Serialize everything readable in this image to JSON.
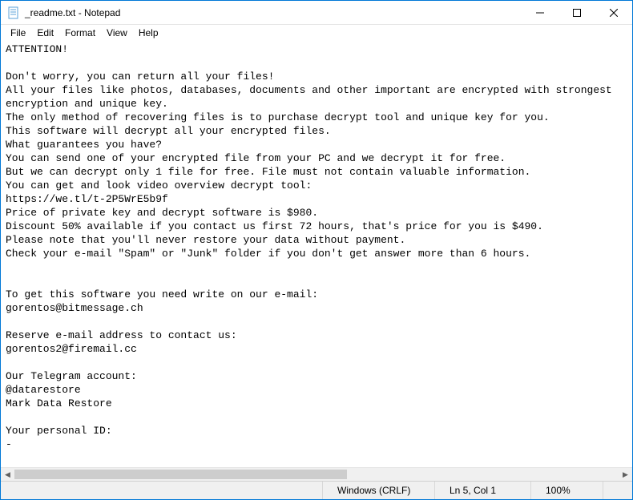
{
  "titlebar": {
    "title": "_readme.txt - Notepad"
  },
  "menubar": {
    "items": [
      "File",
      "Edit",
      "Format",
      "View",
      "Help"
    ]
  },
  "document": {
    "text": "ATTENTION!\n\nDon't worry, you can return all your files!\nAll your files like photos, databases, documents and other important are encrypted with strongest encryption and unique key.\nThe only method of recovering files is to purchase decrypt tool and unique key for you.\nThis software will decrypt all your encrypted files.\nWhat guarantees you have?\nYou can send one of your encrypted file from your PC and we decrypt it for free.\nBut we can decrypt only 1 file for free. File must not contain valuable information.\nYou can get and look video overview decrypt tool:\nhttps://we.tl/t-2P5WrE5b9f\nPrice of private key and decrypt software is $980.\nDiscount 50% available if you contact us first 72 hours, that's price for you is $490.\nPlease note that you'll never restore your data without payment.\nCheck your e-mail \"Spam\" or \"Junk\" folder if you don't get answer more than 6 hours.\n\n\nTo get this software you need write on our e-mail:\ngorentos@bitmessage.ch\n\nReserve e-mail address to contact us:\ngorentos2@firemail.cc\n\nOur Telegram account:\n@datarestore\nMark Data Restore\n\nYour personal ID:\n-"
  },
  "statusbar": {
    "encoding": "Windows (CRLF)",
    "position": "Ln 5, Col 1",
    "zoom": "100%"
  }
}
